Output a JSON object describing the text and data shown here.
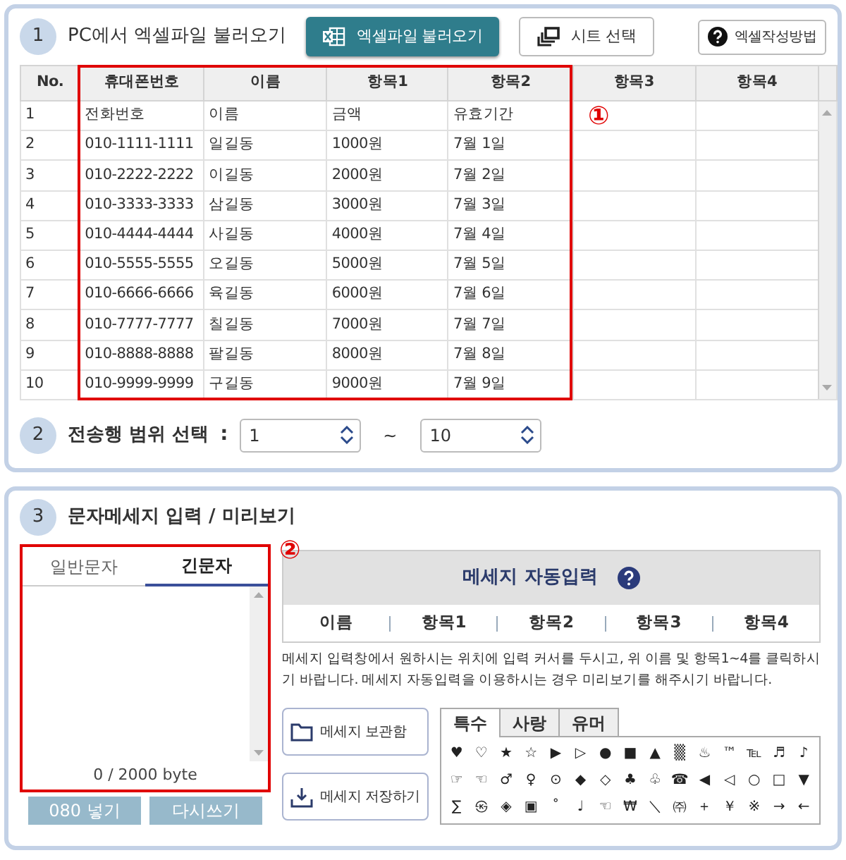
{
  "section1": {
    "number": "1",
    "title": "PC에서 엑셀파일 불러오기",
    "buttons": [
      {
        "label": "엑셀파일 불러오기",
        "kind": "primary"
      },
      {
        "label": "시트 선택",
        "kind": "sheet"
      },
      {
        "label": "엑셀작성방법",
        "kind": "help"
      }
    ],
    "table": {
      "columns": [
        "No.",
        "휴대폰번호",
        "이름",
        "항목1",
        "항목2",
        "항목3",
        "항목4"
      ],
      "rows": [
        [
          "1",
          "전화번호",
          "이름",
          "금액",
          "유효기간"
        ],
        [
          "2",
          "010-1111-1111",
          "일길동",
          "1000원",
          "7월 1일"
        ],
        [
          "3",
          "010-2222-2222",
          "이길동",
          "2000원",
          "7월 2일"
        ],
        [
          "4",
          "010-3333-3333",
          "삼길동",
          "3000원",
          "7월 3일"
        ],
        [
          "5",
          "010-4444-4444",
          "사길동",
          "4000원",
          "7월 4일"
        ],
        [
          "6",
          "010-5555-5555",
          "오길동",
          "5000원",
          "7월 5일"
        ],
        [
          "7",
          "010-6666-6666",
          "육길동",
          "6000원",
          "7월 6일"
        ],
        [
          "8",
          "010-7777-7777",
          "칠길동",
          "7000원",
          "7월 7일"
        ],
        [
          "9",
          "010-8888-8888",
          "팔길동",
          "8000원",
          "7월 8일"
        ],
        [
          "10",
          "010-9999-9999",
          "구길동",
          "9000원",
          "7월 9일"
        ]
      ]
    },
    "annotation": "①"
  },
  "section2": {
    "number": "2",
    "label": "전송행 범위 선택",
    "separator": ":",
    "from": "1",
    "range_sign": "~",
    "to": "10"
  },
  "section3": {
    "number": "3",
    "title": "문자메세지 입력 / 미리보기",
    "annotation": "②",
    "message_tabs": [
      {
        "label": "일반문자",
        "selected": false
      },
      {
        "label": "긴문자",
        "selected": true
      }
    ],
    "byte_count": "0 / 2000 byte",
    "buttons": [
      "080 넣기",
      "다시쓰기"
    ],
    "auto_input": {
      "title": "메세지 자동입력",
      "fields": [
        "이름",
        "항목1",
        "항목2",
        "항목3",
        "항목4"
      ]
    },
    "help_text": "메세지 입력창에서 원하시는 위치에 입력 커서를 두시고, 위 이름 및 항목1~4를 클릭하시기 바랍니다. 메세지 자동입력을 이용하시는 경우 미리보기를 해주시기 바랍니다.",
    "side_buttons": [
      {
        "label": "메세지 보관함",
        "kind": "folder"
      },
      {
        "label": "메세지 저장하기",
        "kind": "save"
      }
    ],
    "symbol_tabs": [
      {
        "label": "특수",
        "selected": true
      },
      {
        "label": "사랑",
        "selected": false
      },
      {
        "label": "유머",
        "selected": false
      }
    ],
    "symbols": [
      [
        "♥",
        "♡",
        "★",
        "☆",
        "▶",
        "▷",
        "●",
        "■",
        "▲",
        "▒",
        "♨",
        "™",
        "℡",
        "♬",
        "♪"
      ],
      [
        "☞",
        "☜",
        "♂",
        "♀",
        "⊙",
        "◆",
        "◇",
        "♣",
        "♧",
        "☎",
        "◀",
        "◁",
        "○",
        "□",
        "▼"
      ],
      [
        "∑",
        "㉿",
        "◈",
        "▣",
        "˚",
        "♩",
        "☜",
        "₩",
        "＼",
        "㈜",
        "＋",
        "￥",
        "※",
        "→",
        "←"
      ]
    ]
  }
}
